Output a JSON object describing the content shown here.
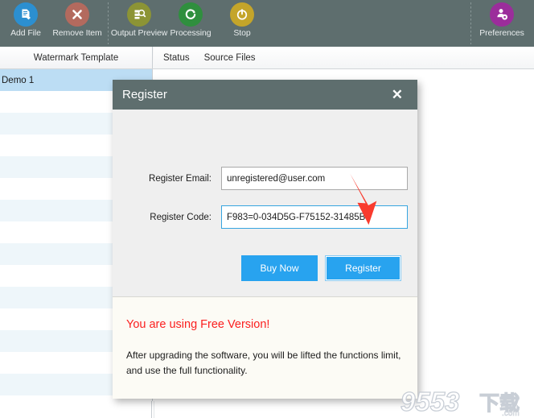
{
  "toolbar": {
    "items": [
      {
        "label": "Add File",
        "icon": "add-file-icon",
        "color": "#2c8fd0"
      },
      {
        "label": "Remove Item",
        "icon": "remove-item-icon",
        "color": "#b36a5e"
      },
      {
        "label": "Output Preview",
        "icon": "output-preview-icon",
        "color": "#8c9435"
      },
      {
        "label": "Processing",
        "icon": "processing-icon",
        "color": "#2f8f3e"
      },
      {
        "label": "Stop",
        "icon": "stop-icon",
        "color": "#c4a52a"
      }
    ],
    "preferences": {
      "label": "Preferences",
      "icon": "preferences-icon",
      "color": "#9b2d9b"
    },
    "background": "#5e6e6e"
  },
  "left_panel": {
    "header": "Watermark Template",
    "rows": [
      {
        "label": "Demo 1",
        "selected": true
      },
      {
        "label": "",
        "selected": false
      },
      {
        "label": "",
        "selected": false
      },
      {
        "label": "",
        "selected": false
      },
      {
        "label": "",
        "selected": false
      },
      {
        "label": "",
        "selected": false
      },
      {
        "label": "",
        "selected": false
      },
      {
        "label": "",
        "selected": false
      },
      {
        "label": "",
        "selected": false
      },
      {
        "label": "",
        "selected": false
      },
      {
        "label": "",
        "selected": false
      },
      {
        "label": "",
        "selected": false
      },
      {
        "label": "",
        "selected": false
      },
      {
        "label": "",
        "selected": false
      },
      {
        "label": "",
        "selected": false
      },
      {
        "label": "",
        "selected": false
      }
    ]
  },
  "right_panel": {
    "columns": [
      "Status",
      "Source Files"
    ]
  },
  "dialog": {
    "title": "Register",
    "close_label": "✕",
    "email": {
      "label": "Register Email:",
      "value": "unregistered@user.com",
      "placeholder": "",
      "focused": false
    },
    "code": {
      "label": "Register Code:",
      "value": "F983=0-034D5G-F75152-31485B",
      "placeholder": "",
      "focused": true
    },
    "buttons": {
      "buy_now": "Buy Now",
      "register": "Register",
      "accent_color": "#28a3ef"
    },
    "message": {
      "title": "You are using Free Version!",
      "title_color": "#fb2020",
      "body": "After upgrading the software, you will be lifted the functions limit, and use the full functionality."
    }
  },
  "annotation": {
    "arrow": {
      "name": "red-down-arrow",
      "color": "#f93b2e"
    }
  },
  "watermark": {
    "text": "9553下载",
    "suffix": ".com"
  }
}
